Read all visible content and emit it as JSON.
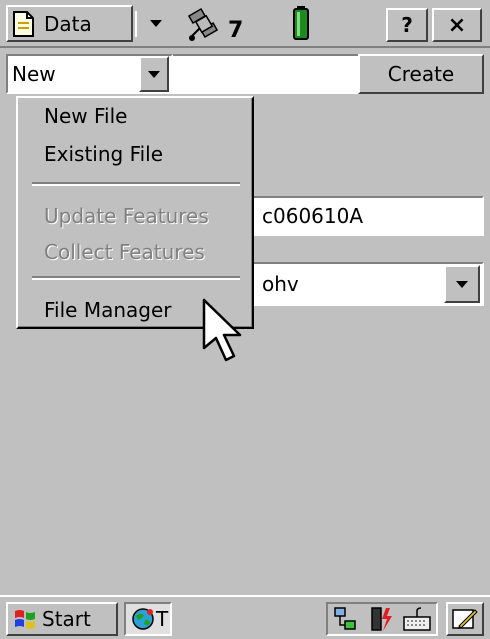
{
  "titlebar": {
    "menu_label": "Data",
    "satellite_count": "7",
    "help_label": "?",
    "close_label": "×"
  },
  "toolbar": {
    "new_value": "New",
    "create_label": "Create"
  },
  "form": {
    "filename_value": "c060610A",
    "dictionary_value": "ohv"
  },
  "menu": {
    "items": [
      {
        "label": "New File",
        "enabled": true
      },
      {
        "label": "Existing File",
        "enabled": true
      },
      {
        "label": "Update Features",
        "enabled": false
      },
      {
        "label": "Collect Features",
        "enabled": false
      },
      {
        "label": "File Manager",
        "enabled": true
      }
    ]
  },
  "taskbar": {
    "start_label": "Start",
    "task_label": "T"
  },
  "icons": {
    "document": "document-icon",
    "satellite": "satellite-icon",
    "battery": "battery-icon",
    "start": "windows-flag-icon",
    "task": "globe-icon",
    "tray": [
      "network-icon",
      "battery-charging-icon",
      "keyboard-icon"
    ],
    "pen": "pen-icon"
  }
}
